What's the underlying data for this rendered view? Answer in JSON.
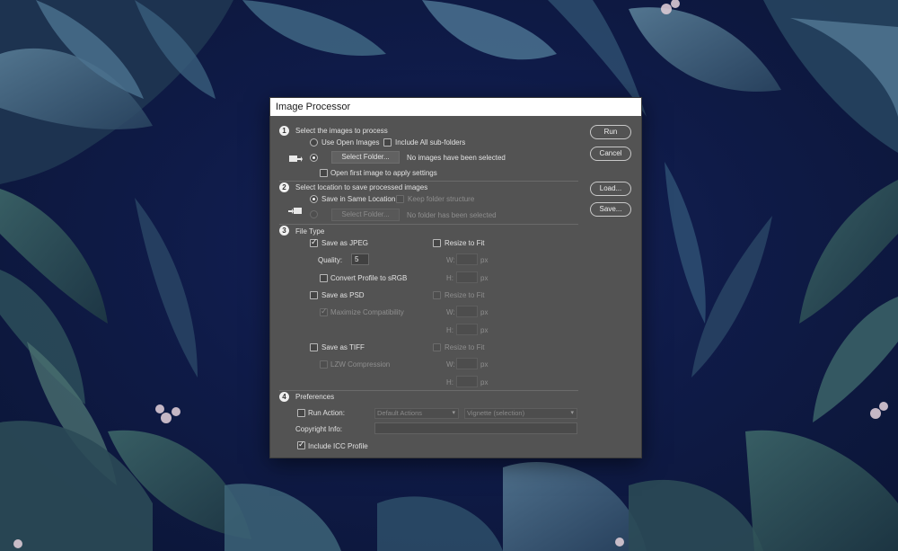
{
  "dialog": {
    "title": "Image Processor",
    "buttons": {
      "run": "Run",
      "cancel": "Cancel",
      "load": "Load...",
      "save": "Save..."
    }
  },
  "step1": {
    "number": "1",
    "heading": "Select the images to process",
    "use_open_images": "Use Open Images",
    "include_subfolders": "Include All sub-folders",
    "select_folder": "Select Folder...",
    "status": "No images have been selected",
    "open_first": "Open first image to apply settings"
  },
  "step2": {
    "number": "2",
    "heading": "Select location to save processed images",
    "save_same": "Save in Same Location",
    "keep_structure": "Keep folder structure",
    "select_folder": "Select Folder...",
    "status": "No folder has been selected"
  },
  "step3": {
    "number": "3",
    "heading": "File Type",
    "jpeg": {
      "label": "Save as JPEG",
      "checked": true,
      "quality_label": "Quality:",
      "quality_value": "5",
      "convert": "Convert Profile to sRGB",
      "resize": "Resize to Fit",
      "w_label": "W:",
      "h_label": "H:",
      "w": "",
      "h": "",
      "unit": "px"
    },
    "psd": {
      "label": "Save as PSD",
      "checked": false,
      "maximize": "Maximize Compatibility",
      "resize": "Resize to Fit",
      "w_label": "W:",
      "h_label": "H:",
      "unit": "px"
    },
    "tiff": {
      "label": "Save as TIFF",
      "checked": false,
      "lzw": "LZW Compression",
      "resize": "Resize to Fit",
      "w_label": "W:",
      "h_label": "H:",
      "unit": "px"
    }
  },
  "step4": {
    "number": "4",
    "heading": "Preferences",
    "run_action": "Run Action:",
    "action_set": "Default Actions",
    "action": "Vignette (selection)",
    "copyright_label": "Copyright Info:",
    "copyright_value": "",
    "include_icc": "Include ICC Profile"
  },
  "colors": {
    "dialog_bg": "#535353",
    "titlebar_bg": "#ffffff",
    "background_navy": "#0f1a3e",
    "leaf_teal": "#3d5f78"
  }
}
